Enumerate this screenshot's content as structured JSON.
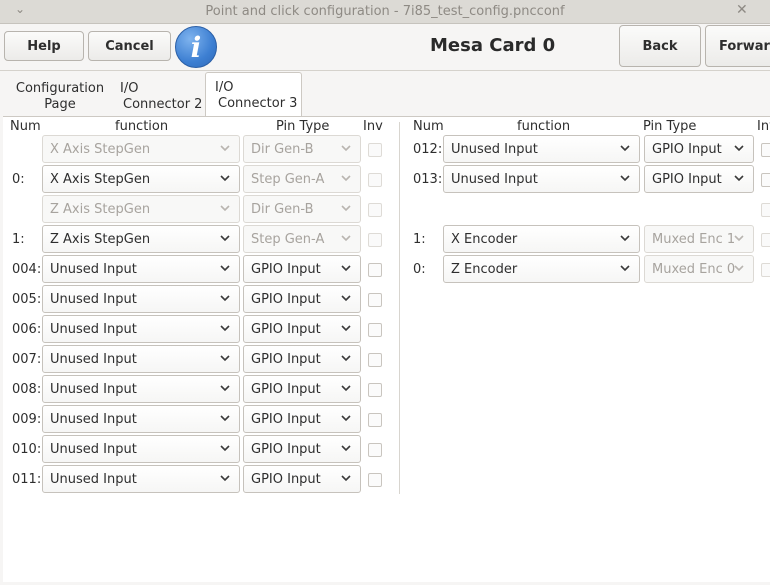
{
  "window": {
    "title": "Point and click configuration - 7i85_test_config.pncconf"
  },
  "toolbar": {
    "help_label": "Help",
    "cancel_label": "Cancel",
    "back_label": "Back",
    "forward_label": "Forward",
    "card_title": "Mesa Card 0"
  },
  "tabs": [
    {
      "line1": "Configuration",
      "line2": "Page"
    },
    {
      "line1": "I/O",
      "line2": "Connector 2"
    },
    {
      "line1": "I/O",
      "line2": "Connector 3"
    }
  ],
  "headers": {
    "num": "Num",
    "function": "function",
    "pin_type": "Pin Type",
    "inv": "Inv"
  },
  "left_rows": [
    {
      "num": "",
      "function": "X Axis StepGen",
      "pin_type": "Dir Gen-B",
      "func_dim": true
    },
    {
      "num": "0:",
      "function": "X Axis StepGen",
      "pin_type": "Step Gen-A",
      "func_dim": false
    },
    {
      "num": "",
      "function": "Z Axis StepGen",
      "pin_type": "Dir Gen-B",
      "func_dim": true
    },
    {
      "num": "1:",
      "function": "Z Axis StepGen",
      "pin_type": "Step Gen-A",
      "func_dim": false
    },
    {
      "num": "004:",
      "function": "Unused Input",
      "pin_type": "GPIO Input",
      "func_dim": false
    },
    {
      "num": "005:",
      "function": "Unused Input",
      "pin_type": "GPIO Input",
      "func_dim": false
    },
    {
      "num": "006:",
      "function": "Unused Input",
      "pin_type": "GPIO Input",
      "func_dim": false
    },
    {
      "num": "007:",
      "function": "Unused Input",
      "pin_type": "GPIO Input",
      "func_dim": false
    },
    {
      "num": "008:",
      "function": "Unused Input",
      "pin_type": "GPIO Input",
      "func_dim": false
    },
    {
      "num": "009:",
      "function": "Unused Input",
      "pin_type": "GPIO Input",
      "func_dim": false
    },
    {
      "num": "010:",
      "function": "Unused Input",
      "pin_type": "GPIO Input",
      "func_dim": false
    },
    {
      "num": "011:",
      "function": "Unused Input",
      "pin_type": "GPIO Input",
      "func_dim": false
    }
  ],
  "right_rows": [
    {
      "num": "012:",
      "function": "Unused Input",
      "pin_type": "GPIO Input"
    },
    {
      "num": "013:",
      "function": "Unused Input",
      "pin_type": "GPIO Input"
    },
    {
      "num": "1:",
      "function": "X Encoder",
      "pin_type": "Muxed Enc 1"
    },
    {
      "num": "0:",
      "function": "Z Encoder",
      "pin_type": "Muxed Enc 0"
    }
  ],
  "colors": {
    "accent_icon": "#3d7fd2",
    "panel": "#ffffff",
    "window": "#f6f5f4"
  },
  "icons": {
    "info": "i"
  }
}
